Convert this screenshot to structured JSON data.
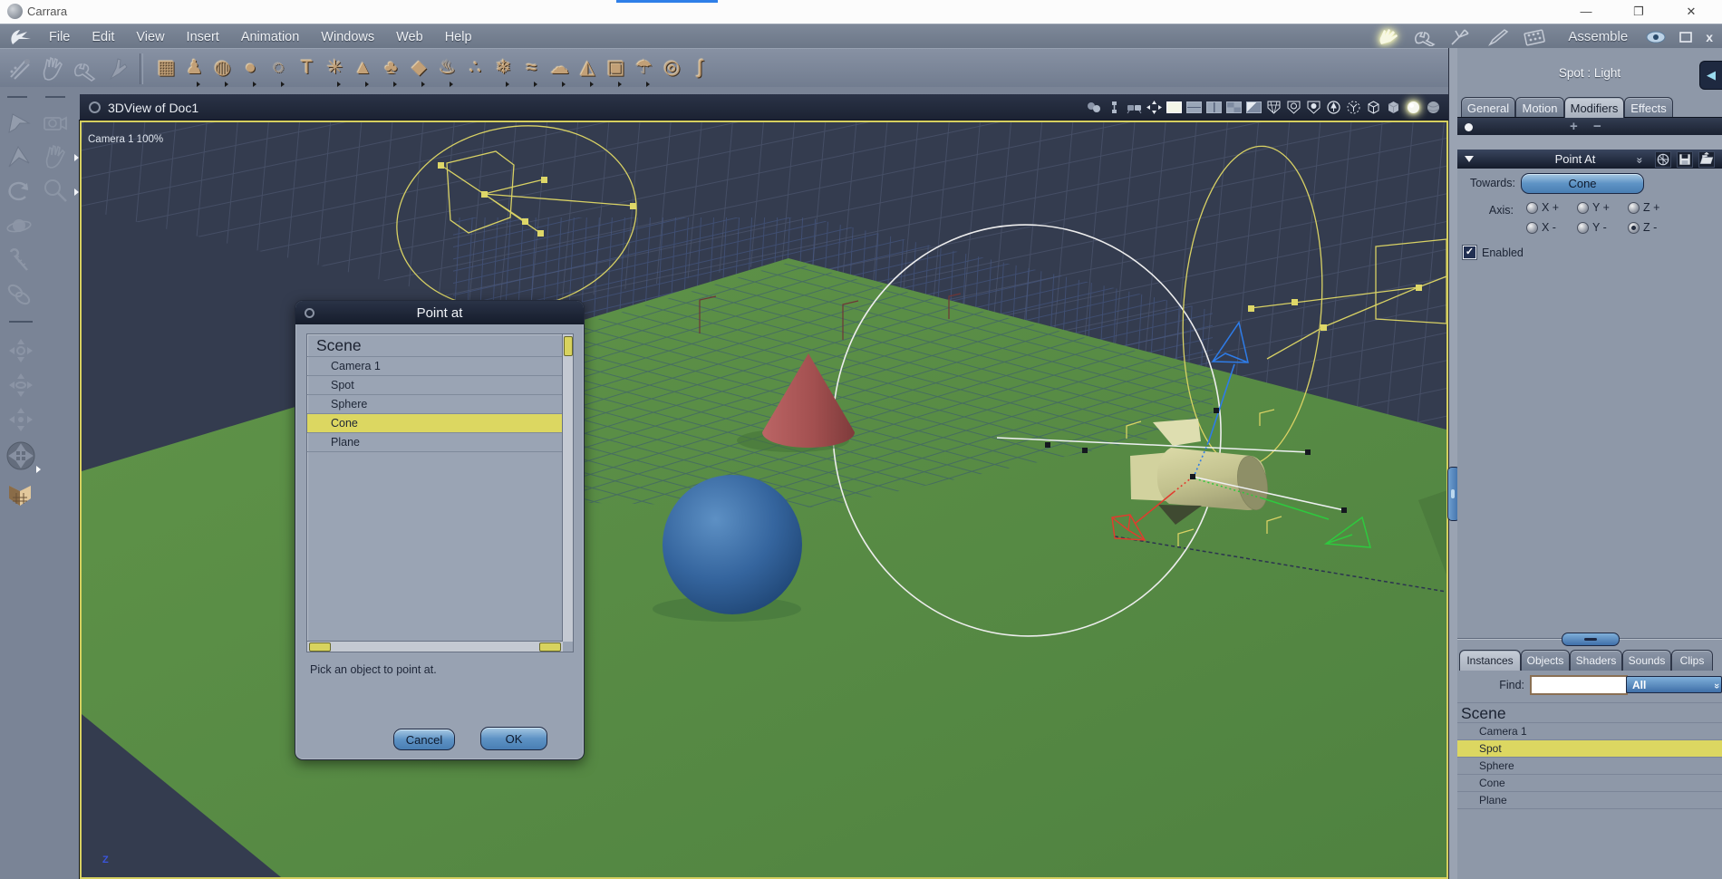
{
  "window": {
    "title": "Carrara",
    "controls": {
      "minimize": "—",
      "restore": "❐",
      "close": "✕"
    }
  },
  "menu": {
    "items": [
      "File",
      "Edit",
      "View",
      "Insert",
      "Animation",
      "Windows",
      "Web",
      "Help"
    ]
  },
  "rooms": {
    "current_label": "Assemble",
    "icons": [
      "assemble-hand",
      "model-wrench",
      "storyboard",
      "texture-brush",
      "render-film"
    ]
  },
  "toolbar": {
    "left_tools": [
      "paint-tool",
      "hand-tool",
      "wrench-tool",
      "pointer-tool"
    ],
    "icons": [
      {
        "name": "insert-floor",
        "glyph": "▦"
      },
      {
        "name": "insert-vertex-object",
        "glyph": "♟"
      },
      {
        "name": "insert-metaball",
        "glyph": "◍"
      },
      {
        "name": "insert-spline-blob",
        "glyph": "●"
      },
      {
        "name": "insert-ring",
        "glyph": "◌"
      },
      {
        "name": "insert-text",
        "glyph": "T"
      },
      {
        "name": "insert-particles",
        "glyph": "✳"
      },
      {
        "name": "insert-terrain",
        "glyph": "▲"
      },
      {
        "name": "insert-tree",
        "glyph": "♣"
      },
      {
        "name": "insert-rock",
        "glyph": "◆"
      },
      {
        "name": "insert-fire",
        "glyph": "♨"
      },
      {
        "name": "insert-rock-pile",
        "glyph": "∴"
      },
      {
        "name": "insert-plant",
        "glyph": "❄"
      },
      {
        "name": "insert-ocean",
        "glyph": "≈"
      },
      {
        "name": "insert-cloud",
        "glyph": "☁"
      },
      {
        "name": "insert-spot-light",
        "glyph": "◭"
      },
      {
        "name": "insert-camera",
        "glyph": "▣"
      },
      {
        "name": "insert-rain",
        "glyph": "☂"
      },
      {
        "name": "insert-ambient-light",
        "glyph": "◎"
      },
      {
        "name": "insert-bone",
        "glyph": "∫"
      }
    ]
  },
  "viewport": {
    "title": "3DView of Doc1",
    "camera_label": "Camera 1 100%",
    "axis_label": "Z"
  },
  "dialog": {
    "title": "Point at",
    "items": [
      {
        "label": "Scene",
        "header": true
      },
      {
        "label": "Camera 1"
      },
      {
        "label": "Spot"
      },
      {
        "label": "Sphere"
      },
      {
        "label": "Cone",
        "selected": true
      },
      {
        "label": "Plane"
      }
    ],
    "message": "Pick an object to point at.",
    "cancel_label": "Cancel",
    "ok_label": "OK"
  },
  "panel": {
    "title": "Spot : Light",
    "tabs": [
      {
        "label": "General"
      },
      {
        "label": "Motion"
      },
      {
        "label": "Modifiers",
        "active": true
      },
      {
        "label": "Effects"
      }
    ],
    "add_label": "+",
    "remove_label": "−",
    "modifier": {
      "title": "Point At",
      "towards_label": "Towards:",
      "towards_value": "Cone",
      "axis_label": "Axis:",
      "axis_options": [
        "X +",
        "Y +",
        "Z +",
        "X -",
        "Y -",
        "Z -"
      ],
      "axis_selected": "Z -",
      "enabled_label": "Enabled",
      "enabled_checked": "✓"
    }
  },
  "browser": {
    "tabs": [
      {
        "label": "Instances",
        "active": true
      },
      {
        "label": "Objects"
      },
      {
        "label": "Shaders"
      },
      {
        "label": "Sounds"
      },
      {
        "label": "Clips"
      }
    ],
    "find_label": "Find:",
    "find_value": "",
    "filter_value": "All",
    "scene_root": "Scene",
    "items": [
      {
        "label": "Camera 1"
      },
      {
        "label": "Spot",
        "selected": true
      },
      {
        "label": "Sphere"
      },
      {
        "label": "Cone"
      },
      {
        "label": "Plane"
      }
    ]
  },
  "colors": {
    "selection_yellow": "#dcd761",
    "wire_yellow": "#d8d164",
    "button_blue": "#5e93c5",
    "viewport_bg": "#343c4f",
    "floor_green": "#5b8d49",
    "gizmo_blue": "#2e7ce8",
    "gizmo_green": "#2ec93e",
    "gizmo_red": "#e23b2e",
    "cone_red": "#a85454",
    "sphere_blue": "#3c6ca2",
    "light_khaki": "#cfce97"
  }
}
